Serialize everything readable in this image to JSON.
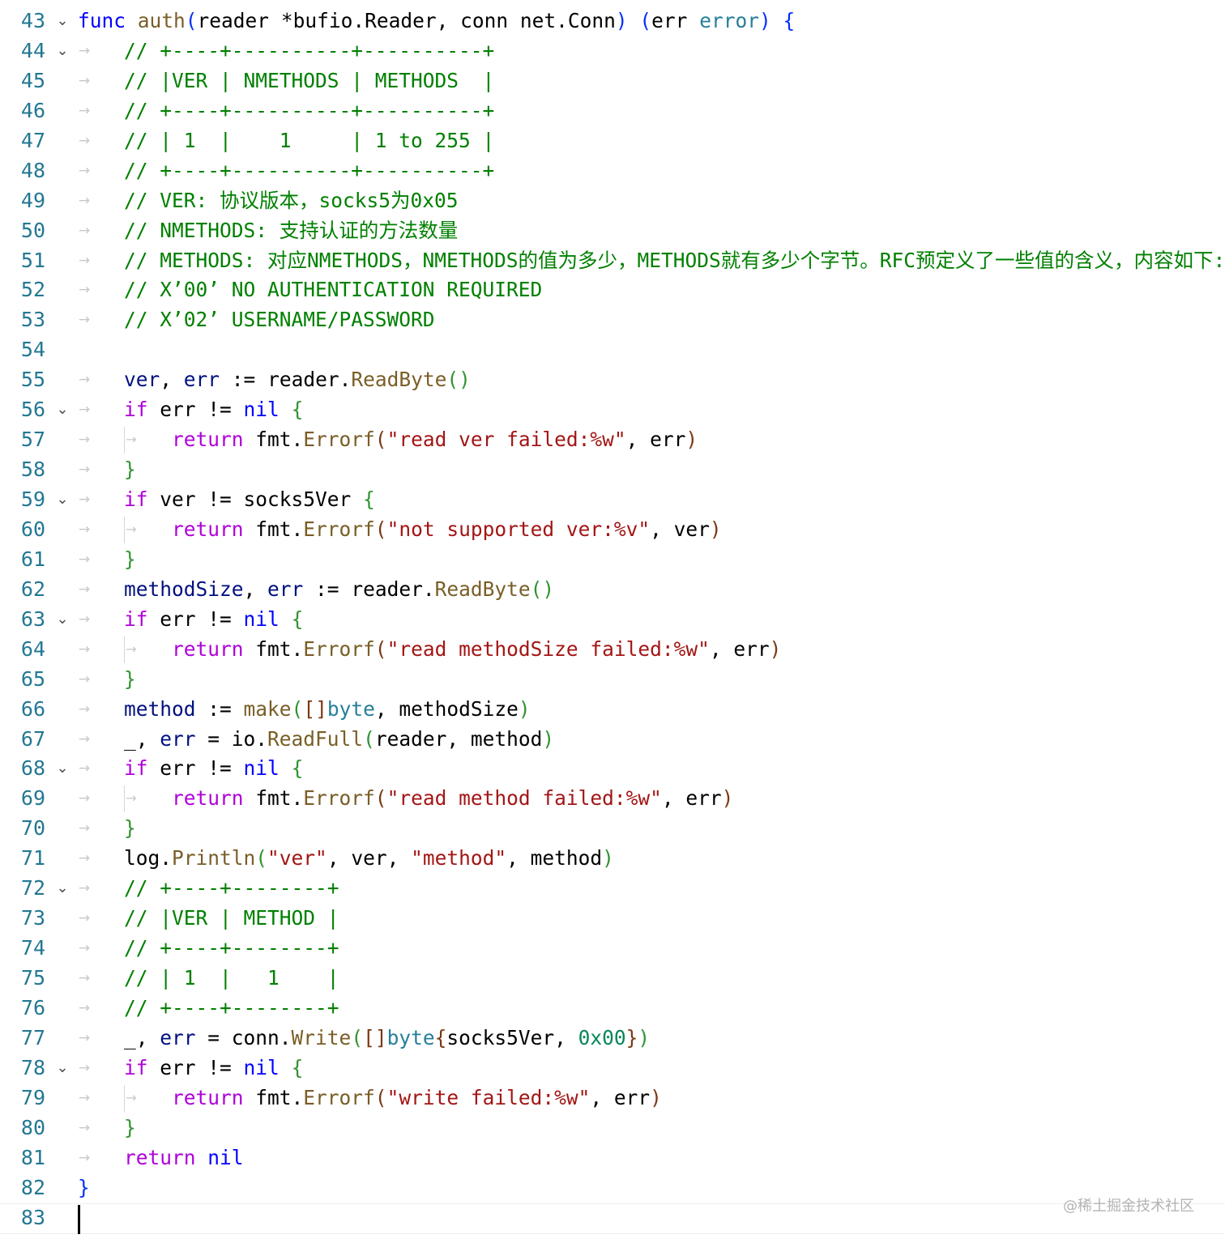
{
  "editor": {
    "lines": [
      {
        "n": "43",
        "fold": true,
        "ws": false,
        "tokens": [
          [
            "kw",
            "func "
          ],
          [
            "fn",
            "auth"
          ],
          [
            "br1",
            "("
          ],
          [
            "",
            "reader "
          ],
          [
            "",
            "*bufio.Reader"
          ],
          [
            "",
            ", "
          ],
          [
            "",
            "conn "
          ],
          [
            "",
            "net.Conn"
          ],
          [
            "br1",
            ")"
          ],
          [
            "",
            " "
          ],
          [
            "br1",
            "("
          ],
          [
            "",
            "err "
          ],
          [
            "ty",
            "error"
          ],
          [
            "br1",
            ")"
          ],
          [
            "",
            " "
          ],
          [
            "br1",
            "{"
          ]
        ]
      },
      {
        "n": "44",
        "fold": true,
        "ws": true,
        "indent": 1,
        "tokens": [
          [
            "com",
            "// +----+----------+----------+"
          ]
        ]
      },
      {
        "n": "45",
        "fold": false,
        "ws": true,
        "indent": 1,
        "tokens": [
          [
            "com",
            "// |VER | NMETHODS | METHODS  |"
          ]
        ]
      },
      {
        "n": "46",
        "fold": false,
        "ws": true,
        "indent": 1,
        "tokens": [
          [
            "com",
            "// +----+----------+----------+"
          ]
        ]
      },
      {
        "n": "47",
        "fold": false,
        "ws": true,
        "indent": 1,
        "tokens": [
          [
            "com",
            "// | 1  |    1     | 1 to 255 |"
          ]
        ]
      },
      {
        "n": "48",
        "fold": false,
        "ws": true,
        "indent": 1,
        "tokens": [
          [
            "com",
            "// +----+----------+----------+"
          ]
        ]
      },
      {
        "n": "49",
        "fold": false,
        "ws": true,
        "indent": 1,
        "tokens": [
          [
            "com",
            "// VER: 协议版本，socks5为0x05"
          ]
        ]
      },
      {
        "n": "50",
        "fold": false,
        "ws": true,
        "indent": 1,
        "tokens": [
          [
            "com",
            "// NMETHODS: 支持认证的方法数量"
          ]
        ]
      },
      {
        "n": "51",
        "fold": false,
        "ws": true,
        "indent": 1,
        "tokens": [
          [
            "com",
            "// METHODS: 对应NMETHODS，NMETHODS的值为多少，METHODS就有多少个字节。RFC预定义了一些值的含义，内容如下:"
          ]
        ]
      },
      {
        "n": "52",
        "fold": false,
        "ws": true,
        "indent": 1,
        "tokens": [
          [
            "com",
            "// X’00’ NO AUTHENTICATION REQUIRED"
          ]
        ]
      },
      {
        "n": "53",
        "fold": false,
        "ws": true,
        "indent": 1,
        "tokens": [
          [
            "com",
            "// X’02’ USERNAME/PASSWORD"
          ]
        ]
      },
      {
        "n": "54",
        "fold": false,
        "ws": false,
        "indent": 1,
        "tokens": []
      },
      {
        "n": "55",
        "fold": false,
        "ws": true,
        "indent": 1,
        "tokens": [
          [
            "var",
            "ver"
          ],
          [
            "",
            ", "
          ],
          [
            "var",
            "err"
          ],
          [
            "",
            " := "
          ],
          [
            "",
            "reader."
          ],
          [
            "fn",
            "ReadByte"
          ],
          [
            "br2",
            "()"
          ]
        ]
      },
      {
        "n": "56",
        "fold": true,
        "ws": true,
        "indent": 1,
        "tokens": [
          [
            "ctl",
            "if "
          ],
          [
            "",
            "err != "
          ],
          [
            "kw",
            "nil"
          ],
          [
            "",
            " "
          ],
          [
            "br2",
            "{"
          ]
        ]
      },
      {
        "n": "57",
        "fold": false,
        "ws": true,
        "indent": 2,
        "guide": true,
        "tokens": [
          [
            "ctl",
            "return "
          ],
          [
            "",
            "fmt."
          ],
          [
            "fn",
            "Errorf"
          ],
          [
            "br3",
            "("
          ],
          [
            "str",
            "\"read ver failed:%w\""
          ],
          [
            "",
            ", err"
          ],
          [
            "br3",
            ")"
          ]
        ]
      },
      {
        "n": "58",
        "fold": false,
        "ws": true,
        "indent": 1,
        "tokens": [
          [
            "br2",
            "}"
          ]
        ]
      },
      {
        "n": "59",
        "fold": true,
        "ws": true,
        "indent": 1,
        "tokens": [
          [
            "ctl",
            "if "
          ],
          [
            "",
            "ver != socks5Ver "
          ],
          [
            "br2",
            "{"
          ]
        ]
      },
      {
        "n": "60",
        "fold": false,
        "ws": true,
        "indent": 2,
        "guide": true,
        "tokens": [
          [
            "ctl",
            "return "
          ],
          [
            "",
            "fmt."
          ],
          [
            "fn",
            "Errorf"
          ],
          [
            "br3",
            "("
          ],
          [
            "str",
            "\"not supported ver:%v\""
          ],
          [
            "",
            ", ver"
          ],
          [
            "br3",
            ")"
          ]
        ]
      },
      {
        "n": "61",
        "fold": false,
        "ws": true,
        "indent": 1,
        "tokens": [
          [
            "br2",
            "}"
          ]
        ]
      },
      {
        "n": "62",
        "fold": false,
        "ws": true,
        "indent": 1,
        "tokens": [
          [
            "var",
            "methodSize"
          ],
          [
            "",
            ", "
          ],
          [
            "var",
            "err"
          ],
          [
            "",
            " := "
          ],
          [
            "",
            "reader."
          ],
          [
            "fn",
            "ReadByte"
          ],
          [
            "br2",
            "()"
          ]
        ]
      },
      {
        "n": "63",
        "fold": true,
        "ws": true,
        "indent": 1,
        "tokens": [
          [
            "ctl",
            "if "
          ],
          [
            "",
            "err != "
          ],
          [
            "kw",
            "nil"
          ],
          [
            "",
            " "
          ],
          [
            "br2",
            "{"
          ]
        ]
      },
      {
        "n": "64",
        "fold": false,
        "ws": true,
        "indent": 2,
        "guide": true,
        "tokens": [
          [
            "ctl",
            "return "
          ],
          [
            "",
            "fmt."
          ],
          [
            "fn",
            "Errorf"
          ],
          [
            "br3",
            "("
          ],
          [
            "str",
            "\"read methodSize failed:%w\""
          ],
          [
            "",
            ", err"
          ],
          [
            "br3",
            ")"
          ]
        ]
      },
      {
        "n": "65",
        "fold": false,
        "ws": true,
        "indent": 1,
        "tokens": [
          [
            "br2",
            "}"
          ]
        ]
      },
      {
        "n": "66",
        "fold": false,
        "ws": true,
        "indent": 1,
        "tokens": [
          [
            "var",
            "method"
          ],
          [
            "",
            " := "
          ],
          [
            "fn",
            "make"
          ],
          [
            "br2",
            "("
          ],
          [
            "br3",
            "[]"
          ],
          [
            "ty",
            "byte"
          ],
          [
            "",
            ", methodSize"
          ],
          [
            "br2",
            ")"
          ]
        ]
      },
      {
        "n": "67",
        "fold": false,
        "ws": true,
        "indent": 1,
        "tokens": [
          [
            "",
            "_, "
          ],
          [
            "var",
            "err"
          ],
          [
            "",
            " = io."
          ],
          [
            "fn",
            "ReadFull"
          ],
          [
            "br2",
            "("
          ],
          [
            "",
            "reader, method"
          ],
          [
            "br2",
            ")"
          ]
        ]
      },
      {
        "n": "68",
        "fold": true,
        "ws": true,
        "indent": 1,
        "tokens": [
          [
            "ctl",
            "if "
          ],
          [
            "",
            "err != "
          ],
          [
            "kw",
            "nil"
          ],
          [
            "",
            " "
          ],
          [
            "br2",
            "{"
          ]
        ]
      },
      {
        "n": "69",
        "fold": false,
        "ws": true,
        "indent": 2,
        "guide": true,
        "tokens": [
          [
            "ctl",
            "return "
          ],
          [
            "",
            "fmt."
          ],
          [
            "fn",
            "Errorf"
          ],
          [
            "br3",
            "("
          ],
          [
            "str",
            "\"read method failed:%w\""
          ],
          [
            "",
            ", err"
          ],
          [
            "br3",
            ")"
          ]
        ]
      },
      {
        "n": "70",
        "fold": false,
        "ws": true,
        "indent": 1,
        "tokens": [
          [
            "br2",
            "}"
          ]
        ]
      },
      {
        "n": "71",
        "fold": false,
        "ws": true,
        "indent": 1,
        "tokens": [
          [
            "",
            "log."
          ],
          [
            "fn",
            "Println"
          ],
          [
            "br2",
            "("
          ],
          [
            "str",
            "\"ver\""
          ],
          [
            "",
            ", ver, "
          ],
          [
            "str",
            "\"method\""
          ],
          [
            "",
            ", method"
          ],
          [
            "br2",
            ")"
          ]
        ]
      },
      {
        "n": "72",
        "fold": true,
        "ws": true,
        "indent": 1,
        "tokens": [
          [
            "com",
            "// +----+--------+"
          ]
        ]
      },
      {
        "n": "73",
        "fold": false,
        "ws": true,
        "indent": 1,
        "tokens": [
          [
            "com",
            "// |VER | METHOD |"
          ]
        ]
      },
      {
        "n": "74",
        "fold": false,
        "ws": true,
        "indent": 1,
        "tokens": [
          [
            "com",
            "// +----+--------+"
          ]
        ]
      },
      {
        "n": "75",
        "fold": false,
        "ws": true,
        "indent": 1,
        "tokens": [
          [
            "com",
            "// | 1  |   1    |"
          ]
        ]
      },
      {
        "n": "76",
        "fold": false,
        "ws": true,
        "indent": 1,
        "tokens": [
          [
            "com",
            "// +----+--------+"
          ]
        ]
      },
      {
        "n": "77",
        "fold": false,
        "ws": true,
        "indent": 1,
        "tokens": [
          [
            "",
            "_, "
          ],
          [
            "var",
            "err"
          ],
          [
            "",
            " = conn."
          ],
          [
            "fn",
            "Write"
          ],
          [
            "br2",
            "("
          ],
          [
            "br3",
            "[]"
          ],
          [
            "ty",
            "byte"
          ],
          [
            "br3",
            "{"
          ],
          [
            "",
            "socks5Ver, "
          ],
          [
            "num",
            "0x00"
          ],
          [
            "br3",
            "}"
          ],
          [
            "br2",
            ")"
          ]
        ]
      },
      {
        "n": "78",
        "fold": true,
        "ws": true,
        "indent": 1,
        "tokens": [
          [
            "ctl",
            "if "
          ],
          [
            "",
            "err != "
          ],
          [
            "kw",
            "nil"
          ],
          [
            "",
            " "
          ],
          [
            "br2",
            "{"
          ]
        ]
      },
      {
        "n": "79",
        "fold": false,
        "ws": true,
        "indent": 2,
        "guide": true,
        "tokens": [
          [
            "ctl",
            "return "
          ],
          [
            "",
            "fmt."
          ],
          [
            "fn",
            "Errorf"
          ],
          [
            "br3",
            "("
          ],
          [
            "str",
            "\"write failed:%w\""
          ],
          [
            "",
            ", err"
          ],
          [
            "br3",
            ")"
          ]
        ]
      },
      {
        "n": "80",
        "fold": false,
        "ws": true,
        "indent": 1,
        "tokens": [
          [
            "br2",
            "}"
          ]
        ]
      },
      {
        "n": "81",
        "fold": false,
        "ws": true,
        "indent": 1,
        "tokens": [
          [
            "ctl",
            "return "
          ],
          [
            "kw",
            "nil"
          ]
        ]
      },
      {
        "n": "82",
        "fold": false,
        "ws": false,
        "indent": 0,
        "tokens": [
          [
            "br1",
            "}"
          ]
        ]
      },
      {
        "n": "83",
        "fold": false,
        "ws": false,
        "indent": 0,
        "tokens": [],
        "cursor": true
      }
    ],
    "fold_glyph": "⌄",
    "ws_glyph": "→",
    "guide_glyph": "→"
  },
  "watermark": "@稀土掘金技术社区",
  "colors": {
    "line_number": "#237893",
    "keyword": "#0000ff",
    "control": "#af00db",
    "function": "#795e26",
    "string": "#a31515",
    "comment": "#008000",
    "type": "#267f99"
  }
}
